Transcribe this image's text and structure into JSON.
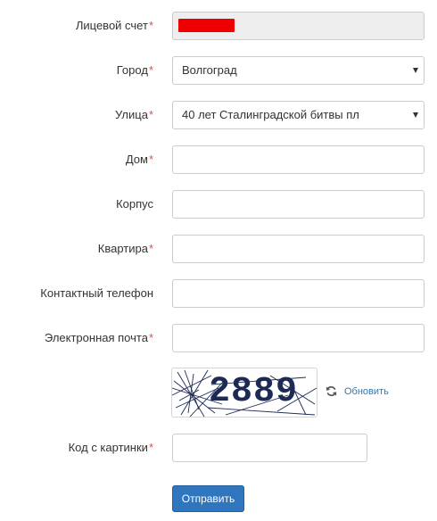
{
  "form": {
    "account": {
      "label": "Лицевой счет",
      "required": "*",
      "value": ""
    },
    "city": {
      "label": "Город",
      "required": "*",
      "value": "Волгоград"
    },
    "street": {
      "label": "Улица",
      "required": "*",
      "value": "40 лет Сталинградской битвы пл"
    },
    "house": {
      "label": "Дом",
      "required": "*",
      "value": ""
    },
    "building": {
      "label": "Корпус",
      "value": ""
    },
    "apartment": {
      "label": "Квартира",
      "required": "*",
      "value": ""
    },
    "phone": {
      "label": "Контактный телефон",
      "value": ""
    },
    "email": {
      "label": "Электронная почта",
      "required": "*",
      "value": ""
    },
    "captcha": {
      "code": "2889",
      "refresh_label": "Обновить",
      "refresh_icon": "refresh-icon"
    },
    "captcha_input": {
      "label": "Код с картинки",
      "required": "*",
      "value": ""
    },
    "submit_label": "Отправить"
  },
  "colors": {
    "required_mark": "#d9534f",
    "redaction": "#ee0000",
    "button": "#2f76bf",
    "link": "#2a7ab8",
    "captcha_text": "#1c2a54"
  }
}
